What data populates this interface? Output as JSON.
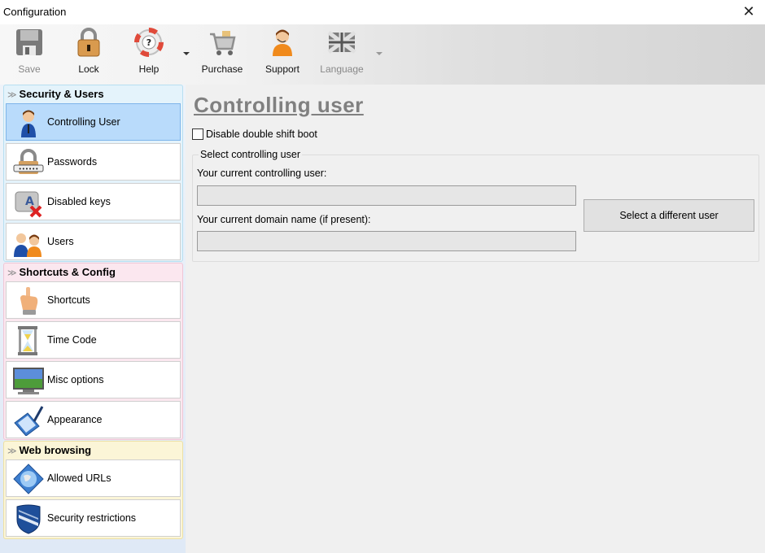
{
  "window": {
    "title": "Configuration",
    "close_glyph": "✕"
  },
  "toolbar": {
    "buttons": [
      {
        "id": "save",
        "label": "Save",
        "icon": "floppy-disk-icon",
        "enabled": false
      },
      {
        "id": "lock",
        "label": "Lock",
        "icon": "padlock-icon",
        "enabled": true
      },
      {
        "id": "help",
        "label": "Help",
        "icon": "lifebuoy-icon",
        "enabled": true,
        "dropdown": true
      },
      {
        "id": "purchase",
        "label": "Purchase",
        "icon": "shopping-cart-icon",
        "enabled": true
      },
      {
        "id": "support",
        "label": "Support",
        "icon": "support-agent-icon",
        "enabled": true
      },
      {
        "id": "language",
        "label": "Language",
        "icon": "uk-flag-icon",
        "enabled": false,
        "dropdown": true
      }
    ]
  },
  "sidebar": {
    "groups": [
      {
        "title": "Security & Users",
        "color": "#e4f3fb",
        "items": [
          {
            "label": "Controlling User",
            "icon": "user-icon",
            "selected": true
          },
          {
            "label": "Passwords",
            "icon": "password-lock-icon",
            "selected": false
          },
          {
            "label": "Disabled keys",
            "icon": "disabled-key-icon",
            "selected": false
          },
          {
            "label": "Users",
            "icon": "users-icon",
            "selected": false
          }
        ]
      },
      {
        "title": "Shortcuts & Config",
        "color": "#fbe7ef",
        "items": [
          {
            "label": "Shortcuts",
            "icon": "pointing-hand-icon",
            "selected": false
          },
          {
            "label": "Time Code",
            "icon": "hourglass-icon",
            "selected": false
          },
          {
            "label": "Misc options",
            "icon": "monitor-icon",
            "selected": false
          },
          {
            "label": "Appearance",
            "icon": "paint-tablet-icon",
            "selected": false
          }
        ]
      },
      {
        "title": "Web browsing",
        "color": "#fbf5d7",
        "items": [
          {
            "label": "Allowed URLs",
            "icon": "globe-icon",
            "selected": false
          },
          {
            "label": "Security restrictions",
            "icon": "shield-icon",
            "selected": false
          }
        ]
      }
    ]
  },
  "main": {
    "title": "Controlling user",
    "disable_double_shift": {
      "label": "Disable double shift boot",
      "checked": false
    },
    "fieldset": {
      "legend": "Select controlling user",
      "current_user_label": "Your current controlling user:",
      "current_user_value": "",
      "domain_label": "Your current domain name (if present):",
      "domain_value": "",
      "select_button": "Select a different user"
    }
  }
}
